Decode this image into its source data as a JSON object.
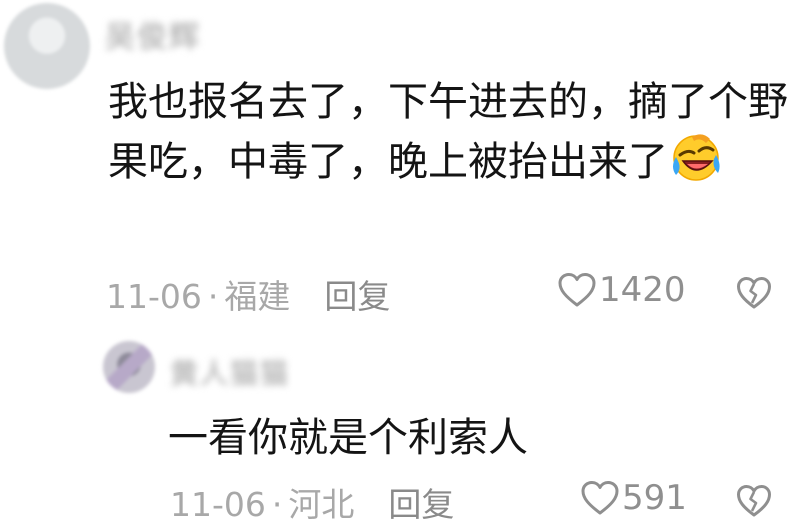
{
  "comment": {
    "username": "吴俊辉",
    "text": "我也报名去了，下午进去的，摘了个野果吃，中毒了，晚上被抬出来了",
    "date": "11-06",
    "location": "福建",
    "reply_label": "回复",
    "likes": "1420",
    "emoji_icon": "rofl-crying-emoji"
  },
  "reply": {
    "username": "黄人猫猫",
    "text": "一看你就是个利索人",
    "date": "11-06",
    "location": "河北",
    "reply_label": "回复",
    "likes": "591"
  },
  "separator": "·",
  "colors": {
    "text": "#141414",
    "meta": "#a8a8a8",
    "icon": "#8f8f8f"
  }
}
